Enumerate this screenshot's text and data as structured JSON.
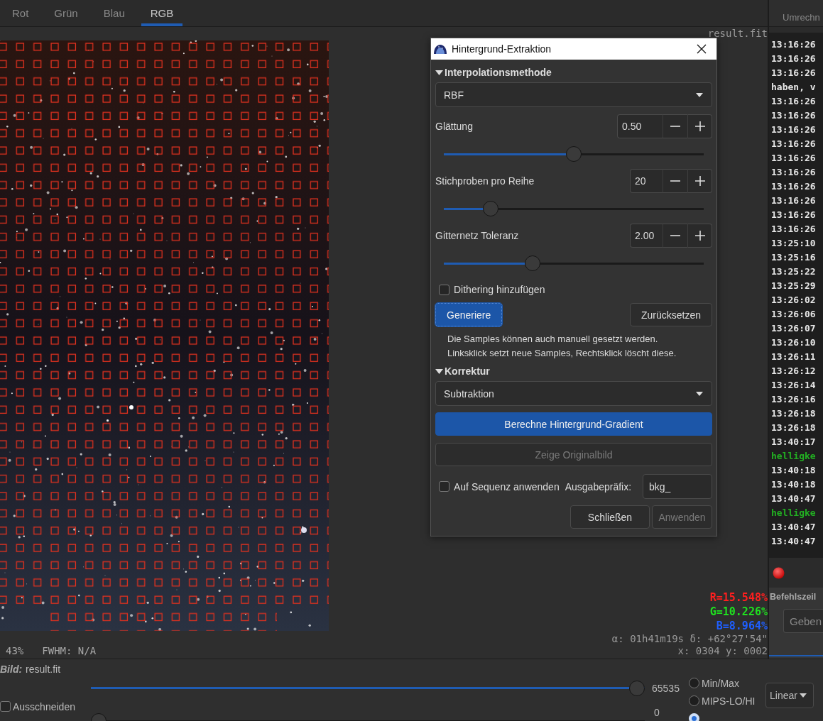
{
  "tabs": [
    {
      "label": "Rot",
      "selected": false
    },
    {
      "label": "Grün",
      "selected": false
    },
    {
      "label": "Blau",
      "selected": false
    },
    {
      "label": "RGB",
      "selected": true
    }
  ],
  "image_view": {
    "filename": "result.fit",
    "zoom": "43%",
    "fwhm": "FWHM: N/A",
    "pixel_values": [
      {
        "text": "R=15.548%",
        "color": "#ff1f1f"
      },
      {
        "text": "G=10.226%",
        "color": "#1fe01f"
      },
      {
        "text": "B=8.964%",
        "color": "#1f5fff"
      }
    ],
    "coordinates": "α: 01h41m19s δ: +62°27'54\"",
    "position": "x: 0304 y: 0002"
  },
  "console": {
    "tab": "Umrechn",
    "lines": [
      {
        "text": "13:16:26",
        "color": "#e6e6e6"
      },
      {
        "text": "13:16:26",
        "color": "#e6e6e6"
      },
      {
        "text": "13:16:26",
        "color": "#e6e6e6"
      },
      {
        "text": "haben, v",
        "color": "#e6e6e6"
      },
      {
        "text": "13:16:26",
        "color": "#e6e6e6"
      },
      {
        "text": "13:16:26",
        "color": "#e6e6e6"
      },
      {
        "text": "13:16:26",
        "color": "#e6e6e6"
      },
      {
        "text": "13:16:26",
        "color": "#e6e6e6"
      },
      {
        "text": "13:16:26",
        "color": "#e6e6e6"
      },
      {
        "text": "13:16:26",
        "color": "#e6e6e6"
      },
      {
        "text": "13:16:26",
        "color": "#e6e6e6"
      },
      {
        "text": "13:16:26",
        "color": "#e6e6e6"
      },
      {
        "text": "13:16:26",
        "color": "#e6e6e6"
      },
      {
        "text": "13:16:26",
        "color": "#e6e6e6"
      },
      {
        "text": "13:25:10",
        "color": "#e6e6e6"
      },
      {
        "text": "13:25:16",
        "color": "#e6e6e6"
      },
      {
        "text": "13:25:22",
        "color": "#e6e6e6"
      },
      {
        "text": "13:25:29",
        "color": "#e6e6e6"
      },
      {
        "text": "13:26:02",
        "color": "#e6e6e6"
      },
      {
        "text": "13:26:06",
        "color": "#e6e6e6"
      },
      {
        "text": "13:26:07",
        "color": "#e6e6e6"
      },
      {
        "text": "13:26:10",
        "color": "#e6e6e6"
      },
      {
        "text": "13:26:11",
        "color": "#e6e6e6"
      },
      {
        "text": "13:26:12",
        "color": "#e6e6e6"
      },
      {
        "text": "13:26:14",
        "color": "#e6e6e6"
      },
      {
        "text": "13:26:16",
        "color": "#e6e6e6"
      },
      {
        "text": "13:26:18",
        "color": "#e6e6e6"
      },
      {
        "text": "13:26:18",
        "color": "#e6e6e6"
      },
      {
        "text": "13:40:17",
        "color": "#e6e6e6"
      },
      {
        "text": "helligke",
        "color": "#22b022"
      },
      {
        "text": "13:40:18",
        "color": "#e6e6e6"
      },
      {
        "text": "13:40:18",
        "color": "#e6e6e6"
      },
      {
        "text": "13:40:47",
        "color": "#e6e6e6"
      },
      {
        "text": "helligke",
        "color": "#22b022"
      },
      {
        "text": "13:40:47",
        "color": "#e6e6e6"
      },
      {
        "text": "13:40:47",
        "color": "#e6e6e6"
      }
    ],
    "command_line": {
      "title": "Befehlszeil",
      "placeholder": "Geben"
    }
  },
  "dialog": {
    "title": "Hintergrund-Extraktion",
    "interpolation": {
      "title": "Interpolationsmethode",
      "expanded": true,
      "method": "RBF",
      "params": [
        {
          "label": "Glättung",
          "value": "0.50",
          "level": 0.5
        },
        {
          "label": "Stichproben pro Reihe",
          "value": "20",
          "level": 0.16
        },
        {
          "label": "Gitternetz Toleranz",
          "value": "2.00",
          "level": 0.33
        }
      ],
      "dithering": {
        "label": "Dithering hinzufügen",
        "checked": false
      },
      "generate_button": {
        "label": "Generiere",
        "kind": "primary",
        "disabled": false
      },
      "reset_button": {
        "label": "Zurücksetzen",
        "kind": "default",
        "disabled": false
      },
      "hint": "Die Samples können auch manuell gesetzt werden.\nLinksklick setzt neue Samples, Rechtsklick löscht diese."
    },
    "correction": {
      "title": "Korrektur",
      "expanded": true,
      "method": "Subtraktion",
      "compute_button": {
        "label": "Berechne Hintergrund-Gradient",
        "kind": "primary",
        "disabled": false
      },
      "show_original_button": {
        "label": "Zeige Originalbild",
        "kind": "default",
        "disabled": true
      }
    },
    "sequence": {
      "label": "Auf Sequenz anwenden",
      "checked": false
    },
    "prefix": {
      "label": "Ausgabepräfix:",
      "value": "bkg_"
    },
    "buttons": [
      {
        "label": "Schließen",
        "kind": "default",
        "disabled": false
      },
      {
        "label": "Anwenden",
        "kind": "default",
        "disabled": true
      }
    ]
  },
  "display_panel": {
    "image_label": "Bild:",
    "image_name": "result.fit",
    "sliders": [
      {
        "level": 1,
        "reading": "65535"
      },
      {
        "level": 0,
        "reading": "0"
      }
    ],
    "crop": {
      "label": "Ausschneiden",
      "checked": false
    },
    "modes": [
      {
        "label": "Min/Max",
        "selected": false
      },
      {
        "label": "MIPS-LO/HI",
        "selected": false
      },
      {
        "selected": true
      }
    ],
    "scale": "Linear"
  }
}
